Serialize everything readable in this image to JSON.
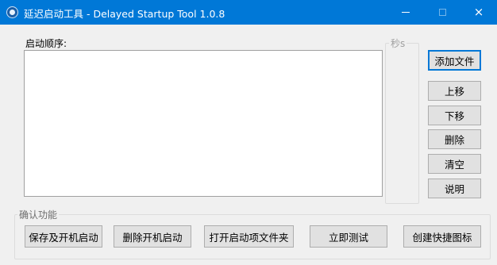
{
  "window": {
    "title": "延迟启动工具 - Delayed Startup Tool 1.0.8",
    "icon": "clock-app-icon",
    "controls": {
      "minimize": "minimize-icon",
      "maximize": "maximize-icon",
      "close": "×"
    }
  },
  "main": {
    "startup_order_label": "启动顺序:",
    "seconds_caption": "秒s",
    "startup_items": []
  },
  "side_buttons": {
    "add_file": "添加文件",
    "move_up": "上移",
    "move_down": "下移",
    "delete": "删除",
    "clear": "清空",
    "help": "说明"
  },
  "confirm_group": {
    "caption": "确认功能",
    "buttons": {
      "save_and_enable": "保存及开机启动",
      "remove_startup": "删除开机启动",
      "open_startup_folder": "打开启动项文件夹",
      "test_now": "立即测试",
      "create_shortcut": "创建快捷图标"
    }
  },
  "colors": {
    "titlebar": "#0078d7",
    "window_bg": "#f0f0f0",
    "button_bg": "#e1e1e1",
    "default_button_border": "#0078d7"
  }
}
